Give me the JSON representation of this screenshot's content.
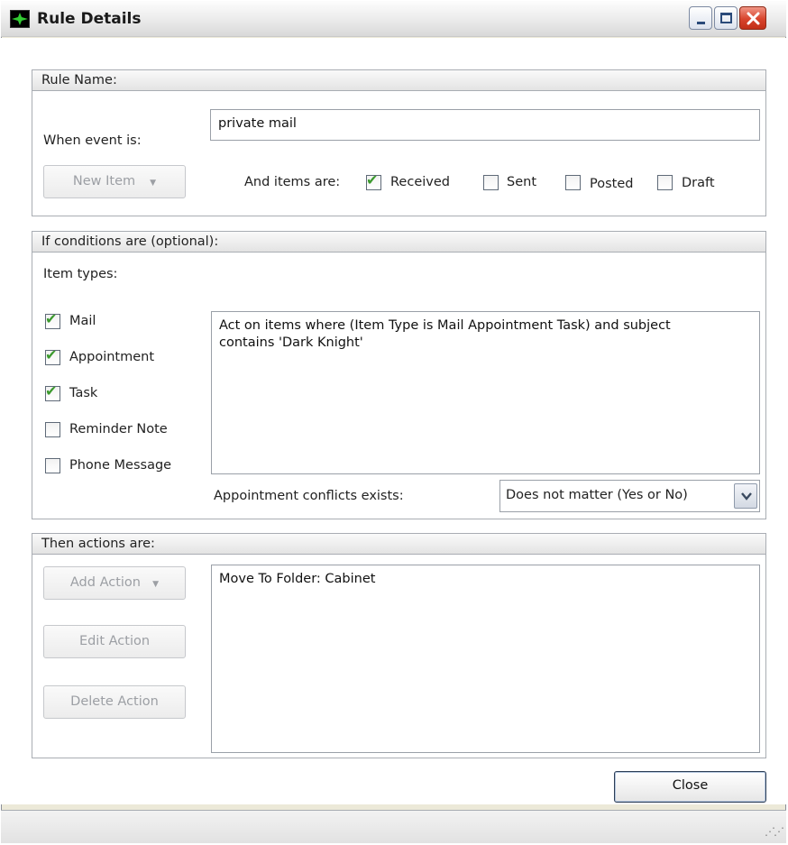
{
  "window": {
    "title": "Rule Details",
    "icon": "app-logo-icon"
  },
  "rule_name_group": {
    "header": "Rule Name:",
    "name_value": "private mail",
    "when_event_label": "When event is:",
    "event_button": "New Item",
    "and_items_label": "And items are:",
    "item_states": [
      {
        "label": "Received",
        "checked": true
      },
      {
        "label": "Sent",
        "checked": false
      },
      {
        "label": "Posted",
        "checked": false
      },
      {
        "label": "Draft",
        "checked": false
      }
    ]
  },
  "conditions_group": {
    "header": "If conditions are (optional):",
    "item_types_label": "Item types:",
    "item_types": [
      {
        "label": "Mail",
        "checked": true
      },
      {
        "label": "Appointment",
        "checked": true
      },
      {
        "label": "Task",
        "checked": true
      },
      {
        "label": "Reminder Note",
        "checked": false
      },
      {
        "label": "Phone Message",
        "checked": false
      }
    ],
    "description": "Act on items where (Item Type is Mail Appointment Task) and subject\ncontains 'Dark Knight'",
    "conflicts_label": "Appointment conflicts exists:",
    "conflicts_value": "Does not matter (Yes or No)"
  },
  "actions_group": {
    "header": "Then actions are:",
    "add_action": "Add Action",
    "edit_action": "Edit Action",
    "delete_action": "Delete Action",
    "actions_text": "Move To Folder: Cabinet"
  },
  "footer": {
    "close_label": "Close"
  },
  "colors": {
    "check": "#3c9a2e",
    "close_caption": "#d8442c",
    "border": "#a9adb3"
  }
}
